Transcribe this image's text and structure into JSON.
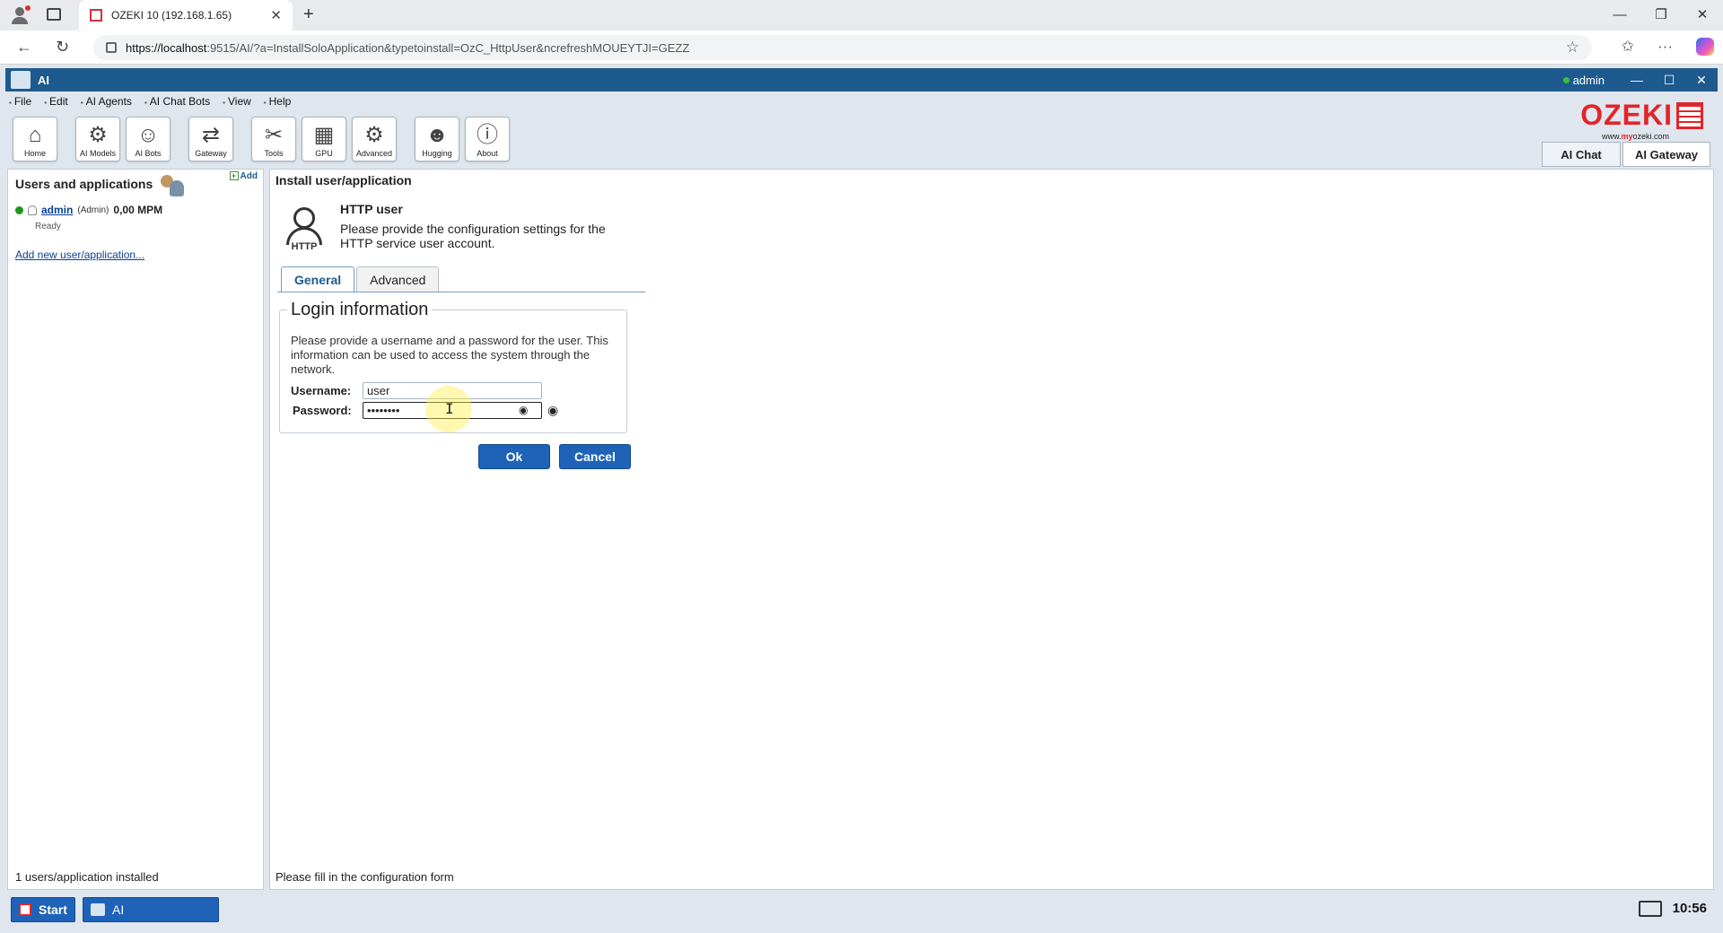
{
  "browser": {
    "tab_title": "OZEKI 10 (192.168.1.65)",
    "url_host": "https://localhost",
    "url_rest": ":9515/AI/?a=InstallSoloApplication&typetoinstall=OzC_HttpUser&ncrefreshMOUEYTJI=GEZZ"
  },
  "app": {
    "title": "AI",
    "user": "admin"
  },
  "menu": [
    "File",
    "Edit",
    "AI Agents",
    "AI Chat Bots",
    "View",
    "Help"
  ],
  "toolbar": {
    "home": "Home",
    "ai_models": "AI Models",
    "ai_bots": "AI Bots",
    "gateway": "Gateway",
    "tools": "Tools",
    "gpu": "GPU",
    "advanced": "Advanced",
    "hugging": "Hugging",
    "about": "About"
  },
  "brand": {
    "name": "OZEKI",
    "site_pre": "www.",
    "site_my": "my",
    "site_post": "ozeki.com"
  },
  "switch": {
    "ai_chat": "AI Chat",
    "ai_gateway": "AI Gateway"
  },
  "left_panel": {
    "title": "Users and applications",
    "add_label": "Add",
    "user_name": "admin",
    "user_role": "Admin",
    "user_rate": "0,00 MPM",
    "user_status": "Ready",
    "add_link": "Add new user/application...",
    "footer": "1 users/application installed"
  },
  "right_panel": {
    "title": "Install user/application",
    "service_title": "HTTP user",
    "service_desc": "Please provide the configuration settings for the HTTP service user account.",
    "http_label": "HTTP",
    "tabs": [
      "General",
      "Advanced"
    ],
    "legend": "Login information",
    "info_text": "Please provide a username and a password for the user. This information can be used to access the system through the network.",
    "username_label": "Username:",
    "username_value": "user",
    "password_label": "Password:",
    "password_value": "••••••••",
    "ok": "Ok",
    "cancel": "Cancel",
    "footer": "Please fill in the configuration form"
  },
  "taskbar": {
    "start": "Start",
    "item": "AI",
    "time": "10:56"
  }
}
